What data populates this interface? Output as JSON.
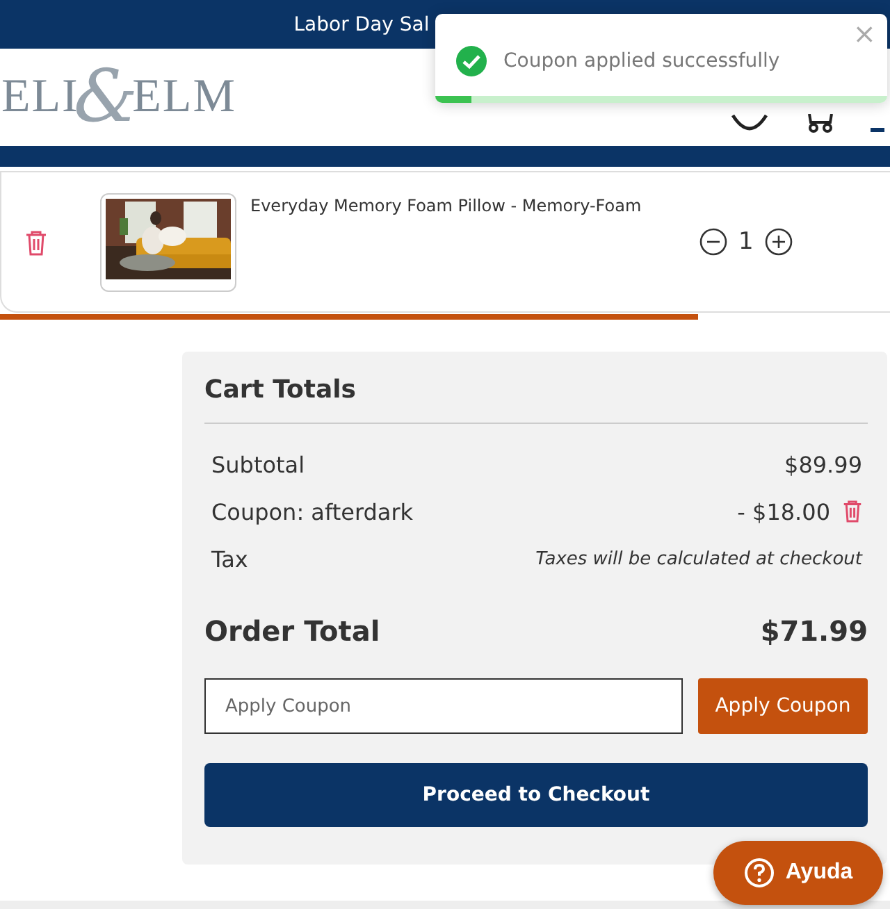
{
  "banner": {
    "text": "Labor Day Sal"
  },
  "toast": {
    "message": "Coupon applied successfully",
    "close": "×",
    "level": 0.08
  },
  "logo": {
    "left": "ELI",
    "amp": "&",
    "right": "ELM"
  },
  "cart_items": [
    {
      "name": "Everyday Memory Foam Pillow - Memory-Foam",
      "quantity": "1"
    }
  ],
  "totals": {
    "title": "Cart Totals",
    "rows": [
      {
        "kind": "amount",
        "label": "Subtotal",
        "value": "$89.99"
      },
      {
        "kind": "coupon",
        "label": "Coupon: afterdark",
        "value": "- $18.00"
      },
      {
        "kind": "note",
        "label": "Tax",
        "value": "Taxes will be calculated at checkout"
      }
    ],
    "order_total": {
      "label": "Order Total",
      "value": "$71.99"
    },
    "coupon_field": {
      "placeholder": "Apply Coupon"
    },
    "apply_button": "Apply Coupon",
    "checkout_button": "Proceed to Checkout"
  },
  "help_button": "Ayuda"
}
